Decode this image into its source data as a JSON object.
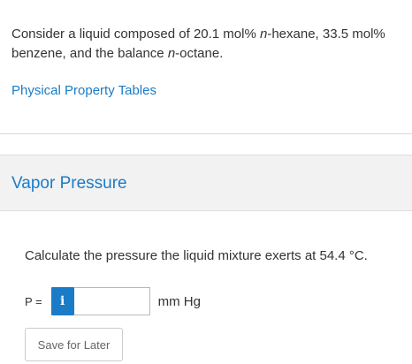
{
  "problem": {
    "line1_a": "Consider a liquid composed of 20.1 mol% ",
    "line1_b": "n",
    "line1_c": "-hexane, 33.5 mol%",
    "line2_a": "benzene, and the balance ",
    "line2_b": "n",
    "line2_c": "-octane."
  },
  "link": {
    "label": "Physical Property Tables"
  },
  "section": {
    "title": "Vapor Pressure"
  },
  "question": {
    "text": "Calculate the pressure the liquid mixture exerts at 54.4 °C."
  },
  "answer": {
    "variable_label": "P =",
    "info_glyph": "i",
    "info_icon": "info-icon",
    "value": "",
    "placeholder": "",
    "unit": "mm Hg"
  },
  "actions": {
    "save_label": "Save for Later"
  },
  "colors": {
    "accent": "#1a7cc6",
    "section_bg": "#f2f2f2",
    "text": "#333333"
  }
}
